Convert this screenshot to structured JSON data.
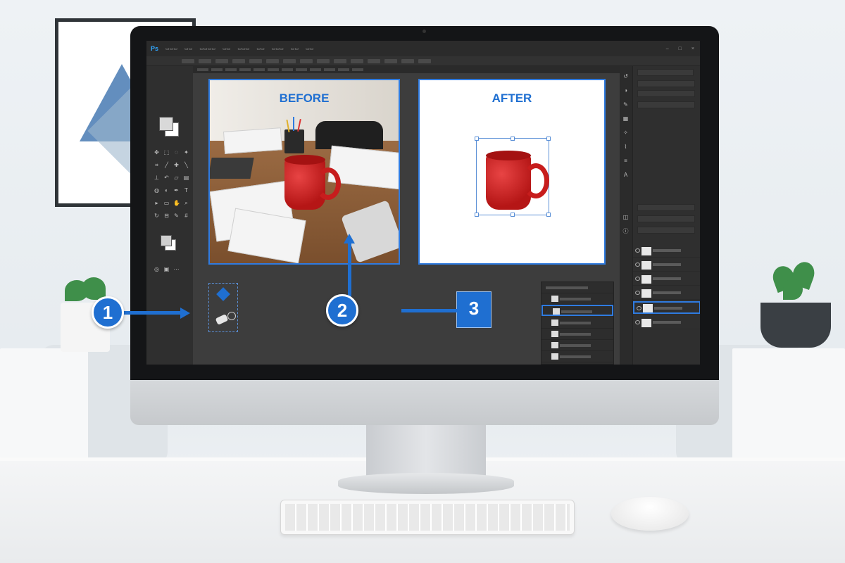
{
  "canvas": {
    "before_label": "BEFORE",
    "after_label": "AFTER"
  },
  "steps": [
    {
      "number": "1"
    },
    {
      "number": "2"
    },
    {
      "number": "3"
    }
  ],
  "colors": {
    "accent": "#1f6fd1",
    "app_bg": "#3b3b3b",
    "panel_bg": "#2f2f2f",
    "mug_red": "#c71d1d"
  },
  "icons": [
    "app-logo-icon",
    "diamond-tool-icon",
    "eraser-tool-icon",
    "eye-icon",
    "layer-thumbnail-icon"
  ]
}
